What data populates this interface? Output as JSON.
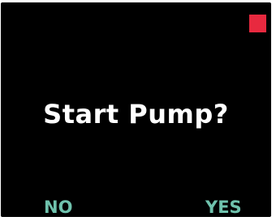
{
  "screen": {
    "prompt": "Start Pump?",
    "status_indicator_color": "#e8293f",
    "accent_color": "#6fc2ad",
    "background_color": "#000000"
  },
  "softkeys": {
    "left_label": "NO",
    "right_label": "YES"
  }
}
